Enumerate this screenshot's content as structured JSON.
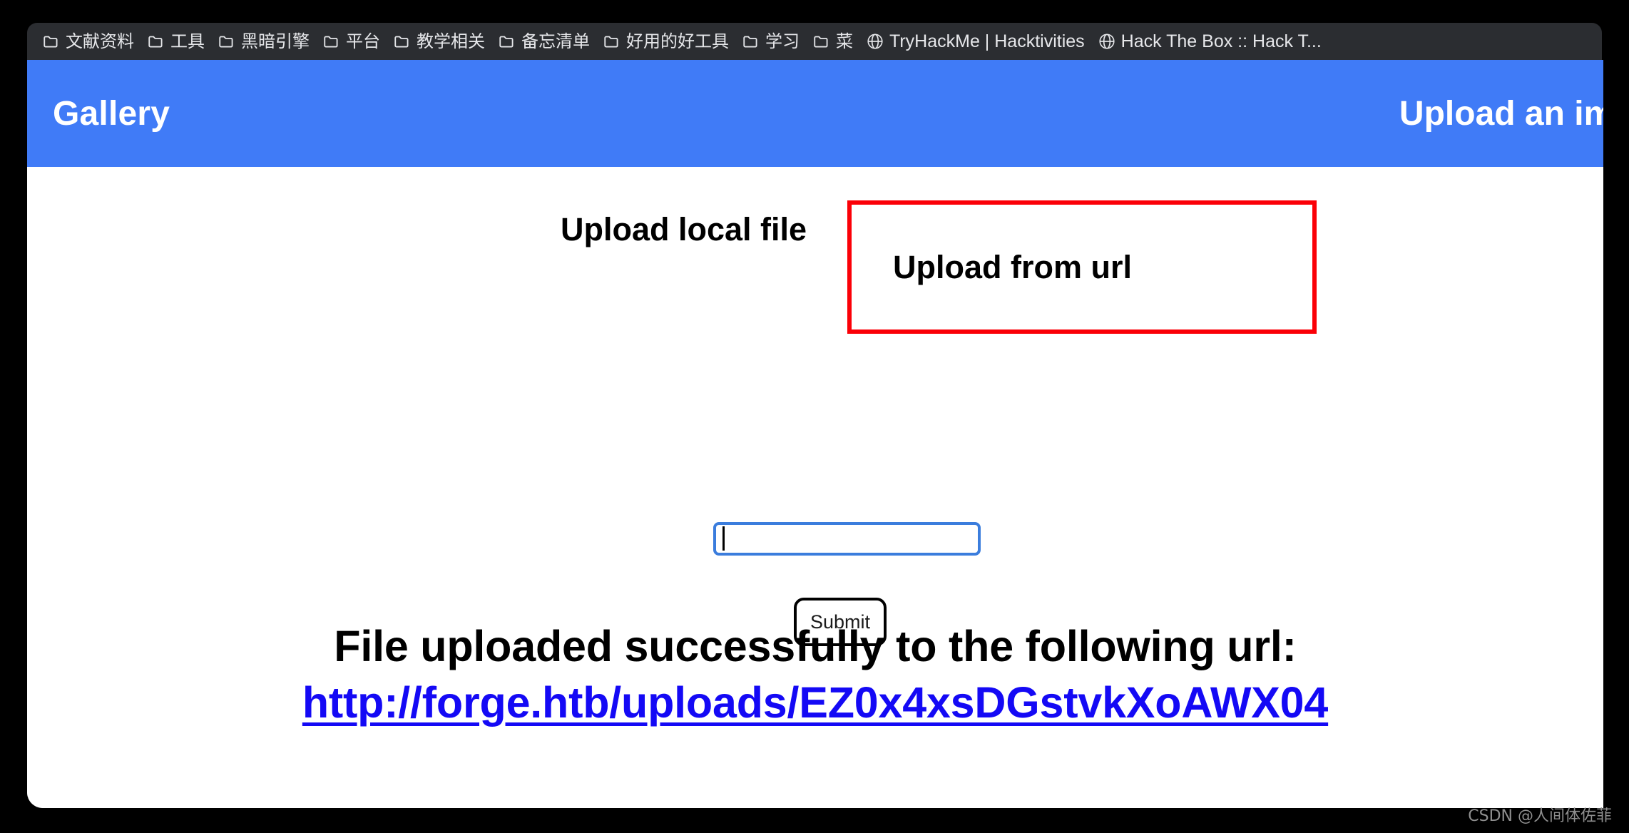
{
  "browser": {
    "bookmarks": [
      {
        "label": "文献资料",
        "icon": "folder-icon",
        "type": "folder"
      },
      {
        "label": "工具",
        "icon": "folder-icon",
        "type": "folder"
      },
      {
        "label": "黑暗引擎",
        "icon": "folder-icon",
        "type": "folder"
      },
      {
        "label": "平台",
        "icon": "folder-icon",
        "type": "folder"
      },
      {
        "label": "教学相关",
        "icon": "folder-icon",
        "type": "folder"
      },
      {
        "label": "备忘清单",
        "icon": "folder-icon",
        "type": "folder"
      },
      {
        "label": "好用的好工具",
        "icon": "folder-icon",
        "type": "folder"
      },
      {
        "label": "学习",
        "icon": "folder-icon",
        "type": "folder"
      },
      {
        "label": "菜",
        "icon": "folder-icon",
        "type": "folder"
      },
      {
        "label": "TryHackMe | Hacktivities",
        "icon": "globe-icon",
        "type": "link"
      },
      {
        "label": "Hack The Box :: Hack T...",
        "icon": "globe-icon",
        "type": "link"
      }
    ]
  },
  "site": {
    "brand": "Gallery",
    "nav": {
      "upload_link": "Upload an image"
    },
    "header_color": "#407bf7"
  },
  "upload": {
    "tabs": [
      {
        "label": "Upload local file",
        "active": false,
        "highlighted": false
      },
      {
        "label": "Upload from url",
        "active": true,
        "highlighted": true
      }
    ],
    "highlight_color": "#fb0007",
    "url_field": {
      "value": "",
      "placeholder": "",
      "focused": true,
      "focus_color": "#3b7ddd"
    },
    "submit_label": "Submit"
  },
  "result": {
    "message": "File uploaded successfully to the following url:",
    "url": "http://forge.htb/uploads/EZ0x4xsDGstvkXoAWX04",
    "link_color": "#1409f5"
  },
  "watermark": {
    "text": "CSDN @人间体佐菲"
  }
}
